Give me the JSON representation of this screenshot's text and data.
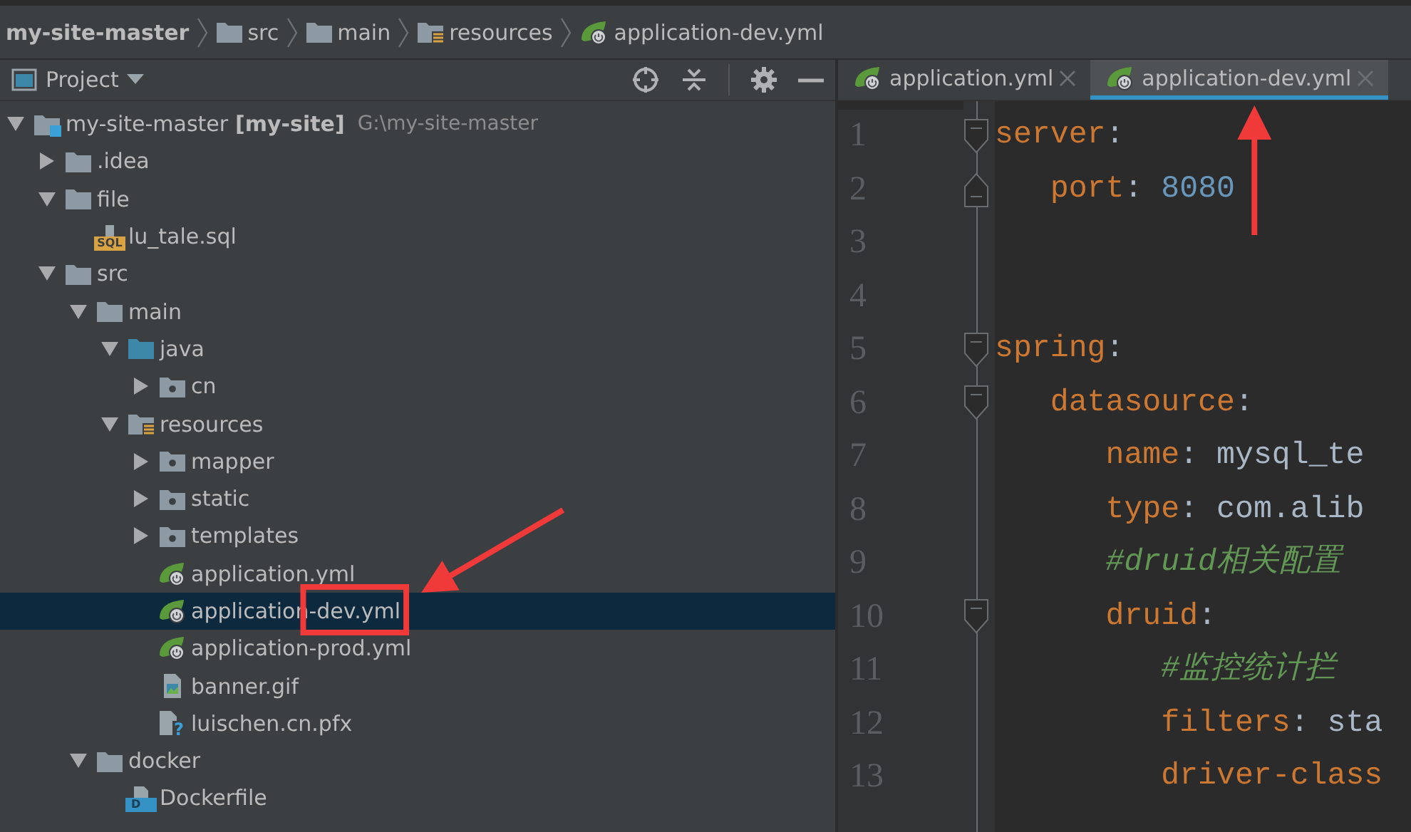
{
  "breadcrumb": [
    {
      "label": "my-site-master",
      "kind": "project",
      "bold": true
    },
    {
      "label": "src",
      "kind": "folder",
      "bold": false
    },
    {
      "label": "main",
      "kind": "folder",
      "bold": false
    },
    {
      "label": "resources",
      "kind": "resources",
      "bold": false
    },
    {
      "label": "application-dev.yml",
      "kind": "spring",
      "bold": false
    }
  ],
  "project_panel": {
    "title": "Project",
    "tree": [
      {
        "name": "my-site-master",
        "module": "[my-site]",
        "path": "G:\\my-site-master",
        "kind": "module",
        "expanded": true,
        "selected": false,
        "children": [
          {
            "name": ".idea",
            "kind": "folder",
            "expanded": false,
            "selected": false
          },
          {
            "name": "file",
            "kind": "folder",
            "expanded": true,
            "selected": false,
            "children": [
              {
                "name": "lu_tale.sql",
                "kind": "sql",
                "icon_label": "SQL",
                "selected": false
              }
            ]
          },
          {
            "name": "src",
            "kind": "folder",
            "expanded": true,
            "selected": false,
            "children": [
              {
                "name": "main",
                "kind": "folder",
                "expanded": true,
                "selected": false,
                "children": [
                  {
                    "name": "java",
                    "kind": "source",
                    "expanded": true,
                    "selected": false,
                    "children": [
                      {
                        "name": "cn",
                        "kind": "package",
                        "expanded": false,
                        "selected": false
                      }
                    ]
                  },
                  {
                    "name": "resources",
                    "kind": "resources",
                    "expanded": true,
                    "selected": false,
                    "children": [
                      {
                        "name": "mapper",
                        "kind": "package",
                        "expanded": false,
                        "selected": false
                      },
                      {
                        "name": "static",
                        "kind": "package",
                        "expanded": false,
                        "selected": false
                      },
                      {
                        "name": "templates",
                        "kind": "package",
                        "expanded": false,
                        "selected": false
                      },
                      {
                        "name": "application.yml",
                        "kind": "spring",
                        "selected": false
                      },
                      {
                        "name": "application-dev.yml",
                        "kind": "spring",
                        "selected": true,
                        "annotated": true
                      },
                      {
                        "name": "application-prod.yml",
                        "kind": "spring",
                        "selected": false
                      },
                      {
                        "name": "banner.gif",
                        "kind": "image",
                        "selected": false
                      },
                      {
                        "name": "luischen.cn.pfx",
                        "kind": "unknown",
                        "icon_label": "?",
                        "selected": false
                      }
                    ]
                  }
                ]
              },
              {
                "name": "docker",
                "kind": "folder",
                "expanded": true,
                "selected": false,
                "children": [
                  {
                    "name": "Dockerfile",
                    "kind": "docker",
                    "icon_label": "D",
                    "selected": false
                  }
                ]
              }
            ]
          }
        ]
      }
    ]
  },
  "editor": {
    "tabs": [
      {
        "label": "application.yml",
        "selected": false
      },
      {
        "label": "application-dev.yml",
        "selected": true,
        "annotated": true
      }
    ],
    "line_numbers": [
      "1",
      "2",
      "3",
      "4",
      "5",
      "6",
      "7",
      "8",
      "9",
      "10",
      "11",
      "12",
      "13"
    ],
    "code": [
      {
        "kind": "key",
        "key": "server",
        "colon": ":",
        "folding": true,
        "children": [
          {
            "kind": "key_number",
            "key": "port",
            "colon": ":",
            "value": "8080",
            "fold_end": true
          }
        ]
      },
      {
        "kind": "blank"
      },
      {
        "kind": "blank"
      },
      {
        "kind": "key",
        "key": "spring",
        "colon": ":",
        "folding": true,
        "children": [
          {
            "kind": "key",
            "key": "datasource",
            "colon": ":",
            "folding": true,
            "children": [
              {
                "kind": "key_text",
                "key": "name",
                "colon": ":",
                "value": "mysql_te"
              },
              {
                "kind": "key_text",
                "key": "type",
                "colon": ":",
                "value": "com.alib"
              },
              {
                "kind": "comment",
                "text": "#druid相关配置"
              },
              {
                "kind": "key",
                "key": "druid",
                "colon": ":",
                "folding": true,
                "children": [
                  {
                    "kind": "comment",
                    "text": "#监控统计拦"
                  },
                  {
                    "kind": "key_text",
                    "key": "filters",
                    "colon": ":",
                    "value": "sta"
                  },
                  {
                    "kind": "plain",
                    "text": "driver-class"
                  }
                ]
              }
            ]
          }
        ]
      }
    ]
  }
}
